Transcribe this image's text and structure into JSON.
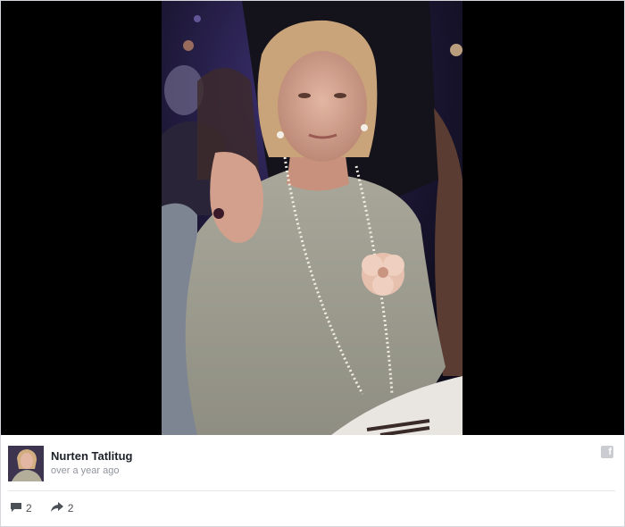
{
  "post": {
    "author_name": "Nurten Tatlitug",
    "timestamp": "over a year ago",
    "comment_count": "2",
    "share_count": "2",
    "photo_description": "",
    "icons": {
      "platform": "facebook-icon",
      "comment": "comment-icon",
      "share": "share-icon"
    }
  },
  "colors": {
    "photo_background": "#000000",
    "name_color": "#1d2129",
    "meta_color": "#90949c",
    "action_color": "#4b4f56"
  }
}
